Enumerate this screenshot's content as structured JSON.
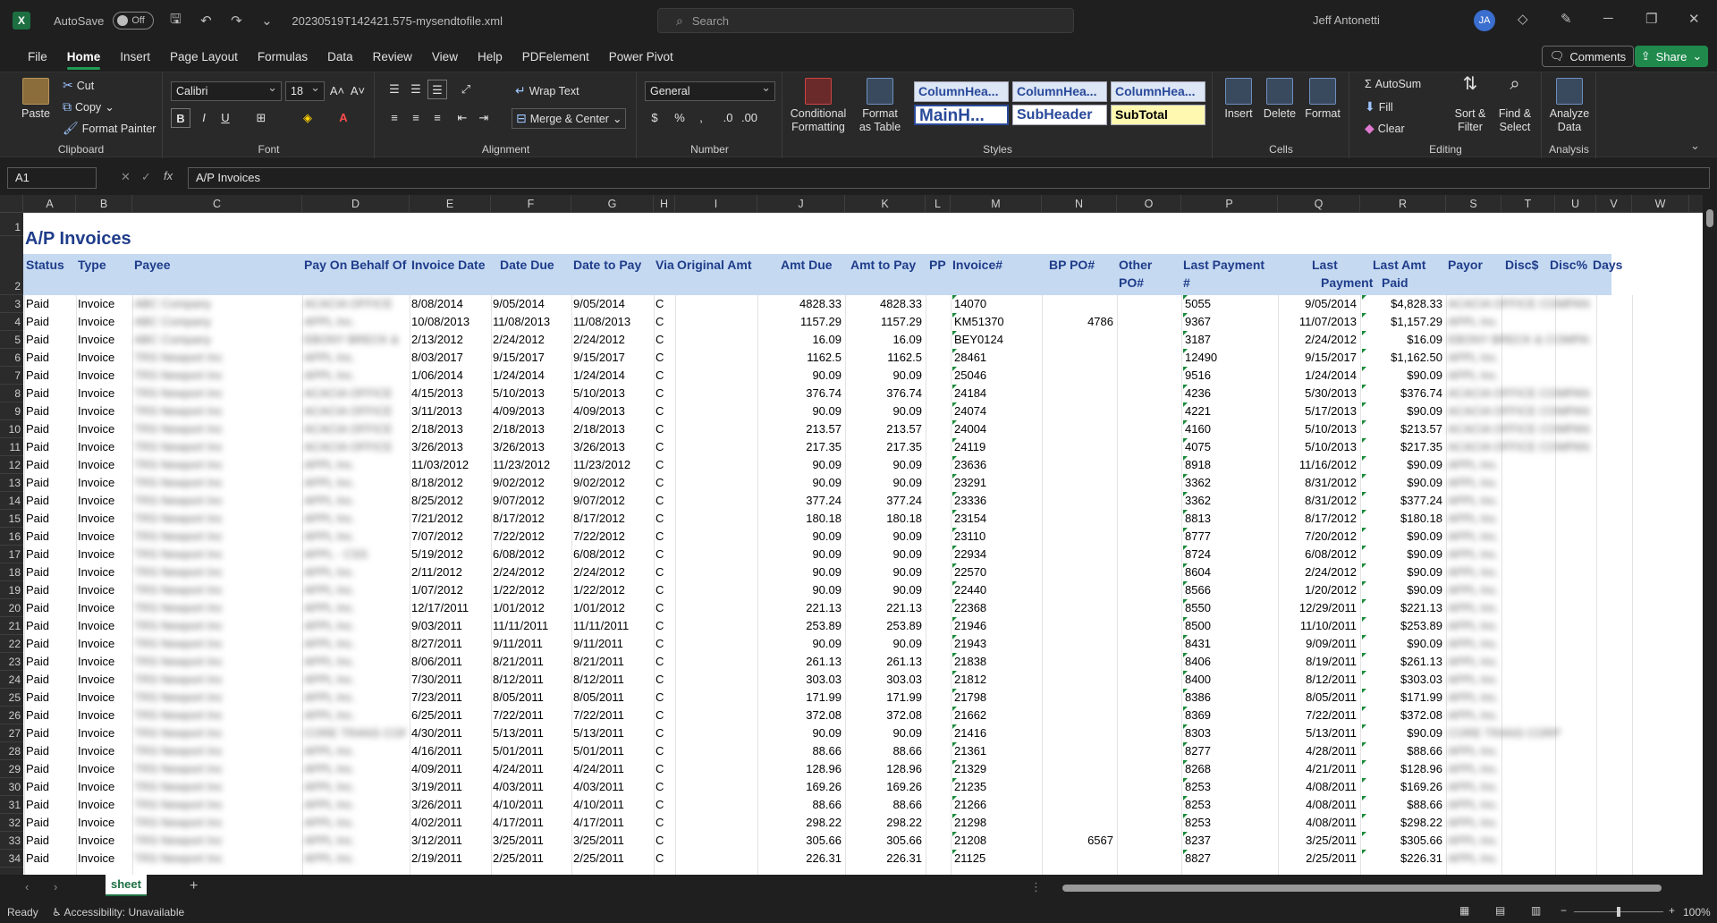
{
  "titlebar": {
    "autosave_label": "AutoSave",
    "autosave_state": "Off",
    "filename": "20230519T142421.575-mysendtofile.xml",
    "search_placeholder": "Search",
    "user_name": "Jeff Antonetti",
    "user_initials": "JA"
  },
  "menu": {
    "tabs": [
      "File",
      "Home",
      "Insert",
      "Page Layout",
      "Formulas",
      "Data",
      "Review",
      "View",
      "Help",
      "PDFelement",
      "Power Pivot"
    ],
    "active": "Home",
    "comments_label": "Comments",
    "share_label": "Share"
  },
  "ribbon": {
    "clipboard": {
      "paste": "Paste",
      "cut": "Cut",
      "copy": "Copy",
      "format_painter": "Format Painter",
      "label": "Clipboard"
    },
    "font": {
      "name": "Calibri",
      "size": "18",
      "label": "Font"
    },
    "alignment": {
      "wrap_text": "Wrap Text",
      "merge_center": "Merge & Center",
      "label": "Alignment"
    },
    "number": {
      "format": "General",
      "label": "Number"
    },
    "styles": {
      "conditional_formatting": "Conditional Formatting",
      "format_as_table": "Format as Table",
      "cells": [
        "ColumnHea...",
        "ColumnHea...",
        "ColumnHea...",
        "MainH...",
        "SubHeader",
        "SubTotal"
      ],
      "label": "Styles"
    },
    "cells": {
      "insert": "Insert",
      "delete": "Delete",
      "format": "Format",
      "label": "Cells"
    },
    "editing": {
      "autosum": "AutoSum",
      "fill": "Fill",
      "clear": "Clear",
      "sort_filter": "Sort & Filter",
      "find_select": "Find & Select",
      "label": "Editing"
    },
    "analysis": {
      "analyze_data": "Analyze Data",
      "label": "Analysis"
    }
  },
  "formula_bar": {
    "name_box": "A1",
    "formula": "A/P Invoices"
  },
  "columns": [
    "A",
    "B",
    "C",
    "D",
    "E",
    "F",
    "G",
    "H",
    "I",
    "J",
    "K",
    "L",
    "M",
    "N",
    "O",
    "P",
    "Q",
    "R",
    "S",
    "T",
    "U",
    "V",
    "W"
  ],
  "sheet": {
    "title": "A/P Invoices",
    "headers": {
      "status": "Status",
      "type": "Type",
      "payee": "Payee",
      "pay_on_behalf_of": "Pay On Behalf Of",
      "invoice_date": "Invoice Date",
      "date_due": "Date Due",
      "date_to_pay": "Date to Pay",
      "via": "Via",
      "original_amt": "Original Amt",
      "amt_due": "Amt Due",
      "amt_to_pay": "Amt to Pay",
      "pp": "PP",
      "invoice_no": "Invoice#",
      "bp_po": "BP PO#",
      "other_po_1": "Other",
      "other_po_2": "PO#",
      "last_payment_no_1": "Last Payment",
      "last_payment_no_2": "#",
      "last_payment_1": "Last",
      "last_payment_2": "Payment",
      "last_amt_paid_1": "Last Amt",
      "last_amt_paid_2": "Paid",
      "payor": "Payor",
      "disc_amt": "Disc$",
      "disc_pct": "Disc%",
      "days": "Days"
    },
    "rows": [
      {
        "n": "3",
        "status": "Paid",
        "type": "Invoice",
        "payee": "ABC Company",
        "behalf": "ACACIA OFFICE",
        "inv_date": "8/08/2014",
        "due": "9/05/2014",
        "to_pay": "9/05/2014",
        "via": "C",
        "amt_due": "4828.33",
        "amt_to_pay": "4828.33",
        "inv": "14070",
        "bp_po": "",
        "last_no": "5055",
        "last_pay": "9/05/2014",
        "last_amt": "$4,828.33",
        "payor": "ACACIA OFFICE COMPANY, INC."
      },
      {
        "n": "4",
        "status": "Paid",
        "type": "Invoice",
        "payee": "ABC Company",
        "behalf": "APPL Inc.",
        "inv_date": "10/08/2013",
        "due": "11/08/2013",
        "to_pay": "11/08/2013",
        "via": "C",
        "amt_due": "1157.29",
        "amt_to_pay": "1157.29",
        "inv": "KM51370",
        "bp_po": "4786",
        "last_no": "9367",
        "last_pay": "11/07/2013",
        "last_amt": "$1,157.29",
        "payor": "APPL Inc."
      },
      {
        "n": "5",
        "status": "Paid",
        "type": "Invoice",
        "payee": "ABC Company",
        "behalf": "EBONY BRECK &",
        "inv_date": "2/13/2012",
        "due": "2/24/2012",
        "to_pay": "2/24/2012",
        "via": "C",
        "amt_due": "16.09",
        "amt_to_pay": "16.09",
        "inv": "BEY0124",
        "bp_po": "",
        "last_no": "3187",
        "last_pay": "2/24/2012",
        "last_amt": "$16.09",
        "payor": "EBONY BRECK & COMPANY"
      },
      {
        "n": "6",
        "status": "Paid",
        "type": "Invoice",
        "payee": "TRS Newport Inc",
        "behalf": "APPL Inc.",
        "inv_date": "8/03/2017",
        "due": "9/15/2017",
        "to_pay": "9/15/2017",
        "via": "C",
        "amt_due": "1162.5",
        "amt_to_pay": "1162.5",
        "inv": "28461",
        "bp_po": "",
        "last_no": "12490",
        "last_pay": "9/15/2017",
        "last_amt": "$1,162.50",
        "payor": "APPL Inc."
      },
      {
        "n": "7",
        "status": "Paid",
        "type": "Invoice",
        "payee": "TRS Newport Inc",
        "behalf": "APPL Inc.",
        "inv_date": "1/06/2014",
        "due": "1/24/2014",
        "to_pay": "1/24/2014",
        "via": "C",
        "amt_due": "90.09",
        "amt_to_pay": "90.09",
        "inv": "25046",
        "bp_po": "",
        "last_no": "9516",
        "last_pay": "1/24/2014",
        "last_amt": "$90.09",
        "payor": "APPL Inc."
      },
      {
        "n": "8",
        "status": "Paid",
        "type": "Invoice",
        "payee": "TRS Newport Inc",
        "behalf": "ACACIA OFFICE",
        "inv_date": "4/15/2013",
        "due": "5/10/2013",
        "to_pay": "5/10/2013",
        "via": "C",
        "amt_due": "376.74",
        "amt_to_pay": "376.74",
        "inv": "24184",
        "bp_po": "",
        "last_no": "4236",
        "last_pay": "5/30/2013",
        "last_amt": "$376.74",
        "payor": "ACACIA OFFICE COMPANY, INC."
      },
      {
        "n": "9",
        "status": "Paid",
        "type": "Invoice",
        "payee": "TRS Newport Inc",
        "behalf": "ACACIA OFFICE",
        "inv_date": "3/11/2013",
        "due": "4/09/2013",
        "to_pay": "4/09/2013",
        "via": "C",
        "amt_due": "90.09",
        "amt_to_pay": "90.09",
        "inv": "24074",
        "bp_po": "",
        "last_no": "4221",
        "last_pay": "5/17/2013",
        "last_amt": "$90.09",
        "payor": "ACACIA OFFICE COMPANY, INC."
      },
      {
        "n": "10",
        "status": "Paid",
        "type": "Invoice",
        "payee": "TRS Newport Inc",
        "behalf": "ACACIA OFFICE",
        "inv_date": "2/18/2013",
        "due": "2/18/2013",
        "to_pay": "2/18/2013",
        "via": "C",
        "amt_due": "213.57",
        "amt_to_pay": "213.57",
        "inv": "24004",
        "bp_po": "",
        "last_no": "4160",
        "last_pay": "5/10/2013",
        "last_amt": "$213.57",
        "payor": "ACACIA OFFICE COMPANY, INC."
      },
      {
        "n": "11",
        "status": "Paid",
        "type": "Invoice",
        "payee": "TRS Newport Inc",
        "behalf": "ACACIA OFFICE",
        "inv_date": "3/26/2013",
        "due": "3/26/2013",
        "to_pay": "3/26/2013",
        "via": "C",
        "amt_due": "217.35",
        "amt_to_pay": "217.35",
        "inv": "24119",
        "bp_po": "",
        "last_no": "4075",
        "last_pay": "5/10/2013",
        "last_amt": "$217.35",
        "payor": "ACACIA OFFICE COMPANY, INC."
      },
      {
        "n": "12",
        "status": "Paid",
        "type": "Invoice",
        "payee": "TRS Newport Inc",
        "behalf": "APPL Inc.",
        "inv_date": "11/03/2012",
        "due": "11/23/2012",
        "to_pay": "11/23/2012",
        "via": "C",
        "amt_due": "90.09",
        "amt_to_pay": "90.09",
        "inv": "23636",
        "bp_po": "",
        "last_no": "8918",
        "last_pay": "11/16/2012",
        "last_amt": "$90.09",
        "payor": "APPL Inc."
      },
      {
        "n": "13",
        "status": "Paid",
        "type": "Invoice",
        "payee": "TRS Newport Inc",
        "behalf": "APPL Inc.",
        "inv_date": "8/18/2012",
        "due": "9/02/2012",
        "to_pay": "9/02/2012",
        "via": "C",
        "amt_due": "90.09",
        "amt_to_pay": "90.09",
        "inv": "23291",
        "bp_po": "",
        "last_no": "3362",
        "last_pay": "8/31/2012",
        "last_amt": "$90.09",
        "payor": "APPL Inc."
      },
      {
        "n": "14",
        "status": "Paid",
        "type": "Invoice",
        "payee": "TRS Newport Inc",
        "behalf": "APPL Inc.",
        "inv_date": "8/25/2012",
        "due": "9/07/2012",
        "to_pay": "9/07/2012",
        "via": "C",
        "amt_due": "377.24",
        "amt_to_pay": "377.24",
        "inv": "23336",
        "bp_po": "",
        "last_no": "3362",
        "last_pay": "8/31/2012",
        "last_amt": "$377.24",
        "payor": "APPL Inc."
      },
      {
        "n": "15",
        "status": "Paid",
        "type": "Invoice",
        "payee": "TRS Newport Inc",
        "behalf": "APPL Inc.",
        "inv_date": "7/21/2012",
        "due": "8/17/2012",
        "to_pay": "8/17/2012",
        "via": "C",
        "amt_due": "180.18",
        "amt_to_pay": "180.18",
        "inv": "23154",
        "bp_po": "",
        "last_no": "8813",
        "last_pay": "8/17/2012",
        "last_amt": "$180.18",
        "payor": "APPL Inc."
      },
      {
        "n": "16",
        "status": "Paid",
        "type": "Invoice",
        "payee": "TRS Newport Inc",
        "behalf": "APPL Inc.",
        "inv_date": "7/07/2012",
        "due": "7/22/2012",
        "to_pay": "7/22/2012",
        "via": "C",
        "amt_due": "90.09",
        "amt_to_pay": "90.09",
        "inv": "23110",
        "bp_po": "",
        "last_no": "8777",
        "last_pay": "7/20/2012",
        "last_amt": "$90.09",
        "payor": "APPL Inc."
      },
      {
        "n": "17",
        "status": "Paid",
        "type": "Invoice",
        "payee": "TRS Newport Inc",
        "behalf": "APPL - CSS",
        "inv_date": "5/19/2012",
        "due": "6/08/2012",
        "to_pay": "6/08/2012",
        "via": "C",
        "amt_due": "90.09",
        "amt_to_pay": "90.09",
        "inv": "22934",
        "bp_po": "",
        "last_no": "8724",
        "last_pay": "6/08/2012",
        "last_amt": "$90.09",
        "payor": "APPL Inc."
      },
      {
        "n": "18",
        "status": "Paid",
        "type": "Invoice",
        "payee": "TRS Newport Inc",
        "behalf": "APPL Inc.",
        "inv_date": "2/11/2012",
        "due": "2/24/2012",
        "to_pay": "2/24/2012",
        "via": "C",
        "amt_due": "90.09",
        "amt_to_pay": "90.09",
        "inv": "22570",
        "bp_po": "",
        "last_no": "8604",
        "last_pay": "2/24/2012",
        "last_amt": "$90.09",
        "payor": "APPL Inc."
      },
      {
        "n": "19",
        "status": "Paid",
        "type": "Invoice",
        "payee": "TRS Newport Inc",
        "behalf": "APPL Inc.",
        "inv_date": "1/07/2012",
        "due": "1/22/2012",
        "to_pay": "1/22/2012",
        "via": "C",
        "amt_due": "90.09",
        "amt_to_pay": "90.09",
        "inv": "22440",
        "bp_po": "",
        "last_no": "8566",
        "last_pay": "1/20/2012",
        "last_amt": "$90.09",
        "payor": "APPL Inc."
      },
      {
        "n": "20",
        "status": "Paid",
        "type": "Invoice",
        "payee": "TRS Newport Inc",
        "behalf": "APPL Inc.",
        "inv_date": "12/17/2011",
        "due": "1/01/2012",
        "to_pay": "1/01/2012",
        "via": "C",
        "amt_due": "221.13",
        "amt_to_pay": "221.13",
        "inv": "22368",
        "bp_po": "",
        "last_no": "8550",
        "last_pay": "12/29/2011",
        "last_amt": "$221.13",
        "payor": "APPL Inc."
      },
      {
        "n": "21",
        "status": "Paid",
        "type": "Invoice",
        "payee": "TRS Newport Inc",
        "behalf": "APPL Inc.",
        "inv_date": "9/03/2011",
        "due": "11/11/2011",
        "to_pay": "11/11/2011",
        "via": "C",
        "amt_due": "253.89",
        "amt_to_pay": "253.89",
        "inv": "21946",
        "bp_po": "",
        "last_no": "8500",
        "last_pay": "11/10/2011",
        "last_amt": "$253.89",
        "payor": "APPL Inc."
      },
      {
        "n": "22",
        "status": "Paid",
        "type": "Invoice",
        "payee": "TRS Newport Inc",
        "behalf": "APPL Inc.",
        "inv_date": "8/27/2011",
        "due": "9/11/2011",
        "to_pay": "9/11/2011",
        "via": "C",
        "amt_due": "90.09",
        "amt_to_pay": "90.09",
        "inv": "21943",
        "bp_po": "",
        "last_no": "8431",
        "last_pay": "9/09/2011",
        "last_amt": "$90.09",
        "payor": "APPL Inc."
      },
      {
        "n": "23",
        "status": "Paid",
        "type": "Invoice",
        "payee": "TRS Newport Inc",
        "behalf": "APPL Inc.",
        "inv_date": "8/06/2011",
        "due": "8/21/2011",
        "to_pay": "8/21/2011",
        "via": "C",
        "amt_due": "261.13",
        "amt_to_pay": "261.13",
        "inv": "21838",
        "bp_po": "",
        "last_no": "8406",
        "last_pay": "8/19/2011",
        "last_amt": "$261.13",
        "payor": "APPL Inc."
      },
      {
        "n": "24",
        "status": "Paid",
        "type": "Invoice",
        "payee": "TRS Newport Inc",
        "behalf": "APPL Inc.",
        "inv_date": "7/30/2011",
        "due": "8/12/2011",
        "to_pay": "8/12/2011",
        "via": "C",
        "amt_due": "303.03",
        "amt_to_pay": "303.03",
        "inv": "21812",
        "bp_po": "",
        "last_no": "8400",
        "last_pay": "8/12/2011",
        "last_amt": "$303.03",
        "payor": "APPL Inc."
      },
      {
        "n": "25",
        "status": "Paid",
        "type": "Invoice",
        "payee": "TRS Newport Inc",
        "behalf": "APPL Inc.",
        "inv_date": "7/23/2011",
        "due": "8/05/2011",
        "to_pay": "8/05/2011",
        "via": "C",
        "amt_due": "171.99",
        "amt_to_pay": "171.99",
        "inv": "21798",
        "bp_po": "",
        "last_no": "8386",
        "last_pay": "8/05/2011",
        "last_amt": "$171.99",
        "payor": "APPL Inc."
      },
      {
        "n": "26",
        "status": "Paid",
        "type": "Invoice",
        "payee": "TRS Newport Inc",
        "behalf": "APPL Inc.",
        "inv_date": "6/25/2011",
        "due": "7/22/2011",
        "to_pay": "7/22/2011",
        "via": "C",
        "amt_due": "372.08",
        "amt_to_pay": "372.08",
        "inv": "21662",
        "bp_po": "",
        "last_no": "8369",
        "last_pay": "7/22/2011",
        "last_amt": "$372.08",
        "payor": "APPL Inc."
      },
      {
        "n": "27",
        "status": "Paid",
        "type": "Invoice",
        "payee": "TRS Newport Inc",
        "behalf": "CORE TRANS CORP",
        "inv_date": "4/30/2011",
        "due": "5/13/2011",
        "to_pay": "5/13/2011",
        "via": "C",
        "amt_due": "90.09",
        "amt_to_pay": "90.09",
        "inv": "21416",
        "bp_po": "",
        "last_no": "8303",
        "last_pay": "5/13/2011",
        "last_amt": "$90.09",
        "payor": "CORE TRANS CORP"
      },
      {
        "n": "28",
        "status": "Paid",
        "type": "Invoice",
        "payee": "TRS Newport Inc",
        "behalf": "APPL Inc.",
        "inv_date": "4/16/2011",
        "due": "5/01/2011",
        "to_pay": "5/01/2011",
        "via": "C",
        "amt_due": "88.66",
        "amt_to_pay": "88.66",
        "inv": "21361",
        "bp_po": "",
        "last_no": "8277",
        "last_pay": "4/28/2011",
        "last_amt": "$88.66",
        "payor": "APPL Inc."
      },
      {
        "n": "29",
        "status": "Paid",
        "type": "Invoice",
        "payee": "TRS Newport Inc",
        "behalf": "APPL Inc.",
        "inv_date": "4/09/2011",
        "due": "4/24/2011",
        "to_pay": "4/24/2011",
        "via": "C",
        "amt_due": "128.96",
        "amt_to_pay": "128.96",
        "inv": "21329",
        "bp_po": "",
        "last_no": "8268",
        "last_pay": "4/21/2011",
        "last_amt": "$128.96",
        "payor": "APPL Inc."
      },
      {
        "n": "30",
        "status": "Paid",
        "type": "Invoice",
        "payee": "TRS Newport Inc",
        "behalf": "APPL Inc.",
        "inv_date": "3/19/2011",
        "due": "4/03/2011",
        "to_pay": "4/03/2011",
        "via": "C",
        "amt_due": "169.26",
        "amt_to_pay": "169.26",
        "inv": "21235",
        "bp_po": "",
        "last_no": "8253",
        "last_pay": "4/08/2011",
        "last_amt": "$169.26",
        "payor": "APPL Inc."
      },
      {
        "n": "31",
        "status": "Paid",
        "type": "Invoice",
        "payee": "TRS Newport Inc",
        "behalf": "APPL Inc.",
        "inv_date": "3/26/2011",
        "due": "4/10/2011",
        "to_pay": "4/10/2011",
        "via": "C",
        "amt_due": "88.66",
        "amt_to_pay": "88.66",
        "inv": "21266",
        "bp_po": "",
        "last_no": "8253",
        "last_pay": "4/08/2011",
        "last_amt": "$88.66",
        "payor": "APPL Inc."
      },
      {
        "n": "32",
        "status": "Paid",
        "type": "Invoice",
        "payee": "TRS Newport Inc",
        "behalf": "APPL Inc.",
        "inv_date": "4/02/2011",
        "due": "4/17/2011",
        "to_pay": "4/17/2011",
        "via": "C",
        "amt_due": "298.22",
        "amt_to_pay": "298.22",
        "inv": "21298",
        "bp_po": "",
        "last_no": "8253",
        "last_pay": "4/08/2011",
        "last_amt": "$298.22",
        "payor": "APPL Inc."
      },
      {
        "n": "33",
        "status": "Paid",
        "type": "Invoice",
        "payee": "TRS Newport Inc",
        "behalf": "APPL Inc.",
        "inv_date": "3/12/2011",
        "due": "3/25/2011",
        "to_pay": "3/25/2011",
        "via": "C",
        "amt_due": "305.66",
        "amt_to_pay": "305.66",
        "inv": "21208",
        "bp_po": "6567",
        "last_no": "8237",
        "last_pay": "3/25/2011",
        "last_amt": "$305.66",
        "payor": "APPL Inc."
      },
      {
        "n": "34",
        "status": "Paid",
        "type": "Invoice",
        "payee": "TRS Newport Inc",
        "behalf": "APPL Inc.",
        "inv_date": "2/19/2011",
        "due": "2/25/2011",
        "to_pay": "2/25/2011",
        "via": "C",
        "amt_due": "226.31",
        "amt_to_pay": "226.31",
        "inv": "21125",
        "bp_po": "",
        "last_no": "8827",
        "last_pay": "2/25/2011",
        "last_amt": "$226.31",
        "payor": "APPL Inc."
      }
    ]
  },
  "tabs": {
    "sheet_name": "sheet",
    "add_sheet": "+"
  },
  "status": {
    "ready": "Ready",
    "accessibility": "Accessibility: Unavailable",
    "zoom": "100%"
  }
}
